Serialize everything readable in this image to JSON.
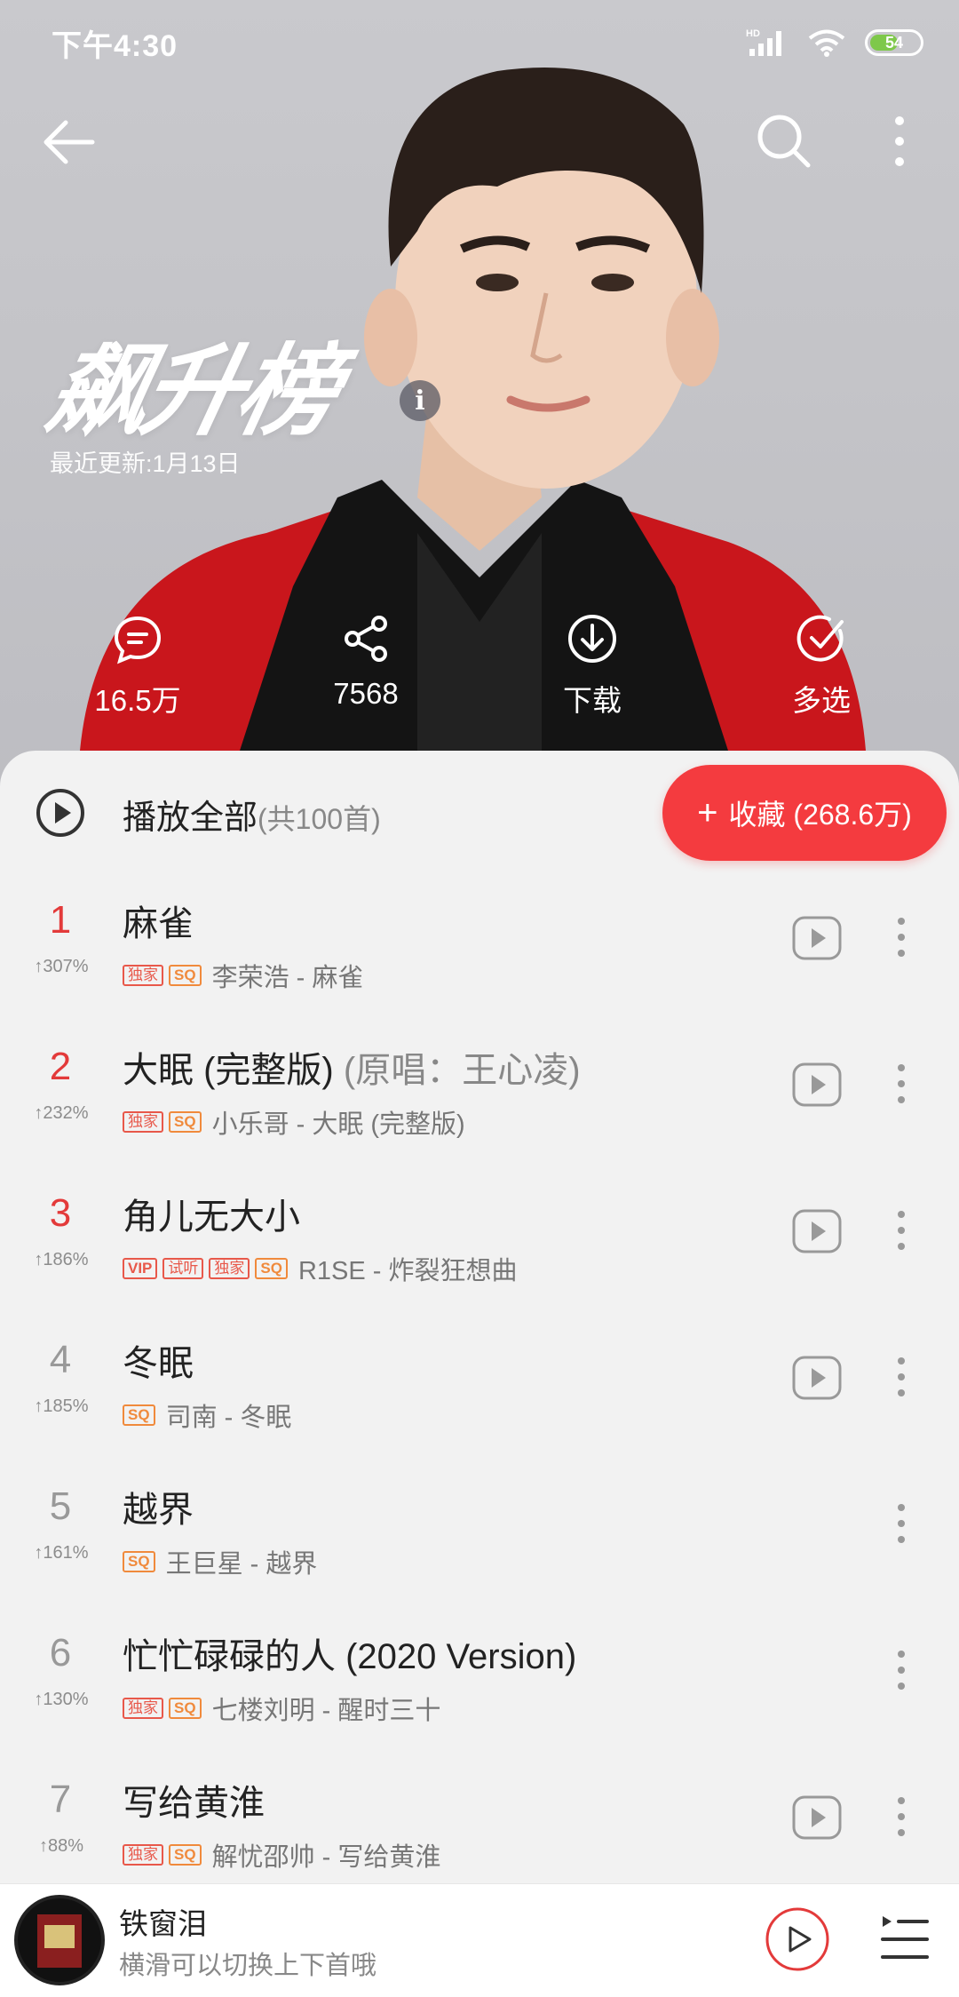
{
  "status_bar": {
    "time": "下午4:30",
    "network": "HD",
    "battery": "54"
  },
  "header": {
    "title": "飙升榜",
    "update": "最近更新:1月13日"
  },
  "actions": [
    {
      "icon": "comment-icon",
      "label": "16.5万"
    },
    {
      "icon": "share-icon",
      "label": "7568"
    },
    {
      "icon": "download-icon",
      "label": "下载"
    },
    {
      "icon": "multiselect-icon",
      "label": "多选"
    }
  ],
  "play_all": {
    "label": "播放全部",
    "count": "(共100首)",
    "collect": "收藏 (268.6万)"
  },
  "songs": [
    {
      "rank": "1",
      "trend": "↑307%",
      "title": "麻雀",
      "original": "",
      "tags": [
        "独家",
        "SQ"
      ],
      "meta": "李荣浩 - 麻雀",
      "mv": true
    },
    {
      "rank": "2",
      "trend": "↑232%",
      "title": "大眠 (完整版)",
      "original": " (原唱：王心凌)",
      "tags": [
        "独家",
        "SQ"
      ],
      "meta": "小乐哥 - 大眠 (完整版)",
      "mv": true
    },
    {
      "rank": "3",
      "trend": "↑186%",
      "title": "角儿无大小",
      "original": "",
      "tags": [
        "VIP",
        "试听",
        "独家",
        "SQ"
      ],
      "meta": "R1SE - 炸裂狂想曲",
      "mv": true
    },
    {
      "rank": "4",
      "trend": "↑185%",
      "title": "冬眠",
      "original": "",
      "tags": [
        "SQ"
      ],
      "meta": "司南 - 冬眠",
      "mv": true
    },
    {
      "rank": "5",
      "trend": "↑161%",
      "title": "越界",
      "original": "",
      "tags": [
        "SQ"
      ],
      "meta": "王巨星 - 越界",
      "mv": false
    },
    {
      "rank": "6",
      "trend": "↑130%",
      "title": "忙忙碌碌的人 (2020 Version)",
      "original": "",
      "tags": [
        "独家",
        "SQ"
      ],
      "meta": "七楼刘明 - 醒时三十",
      "mv": false
    },
    {
      "rank": "7",
      "trend": "↑88%",
      "title": "写给黄淮",
      "original": "",
      "tags": [
        "独家",
        "SQ"
      ],
      "meta": "解忧邵帅 - 写给黄淮",
      "mv": true
    }
  ],
  "mini_player": {
    "title": "铁窗泪",
    "hint": "横滑可以切换上下首哦"
  },
  "colors": {
    "accent": "#f43b3f",
    "rank_top": "#e33a3a",
    "tag_red": "#e8584a",
    "tag_sq": "#f08a3c"
  }
}
